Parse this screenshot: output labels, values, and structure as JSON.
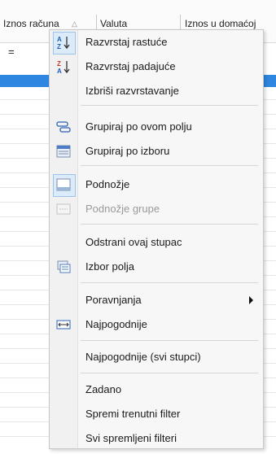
{
  "header": {
    "col1": "Iznos računa",
    "col2": "Valuta",
    "col3": "Iznos u domaćoj"
  },
  "filter_row": {
    "value": "="
  },
  "menu": {
    "items": [
      {
        "label": "Razvrstaj rastuće",
        "icon": "sort-ascending-icon"
      },
      {
        "label": "Razvrstaj padajuće",
        "icon": "sort-descending-icon"
      },
      {
        "label": "Izbriši razvrstavanje",
        "icon": ""
      },
      {
        "label": "Grupiraj po ovom polju",
        "icon": "group-by-field-icon"
      },
      {
        "label": "Grupiraj po izboru",
        "icon": "group-by-selection-icon"
      },
      {
        "label": "Podnožje",
        "icon": "footer-icon"
      },
      {
        "label": "Podnožje grupe",
        "icon": "group-footer-icon",
        "disabled": true
      },
      {
        "label": "Odstrani ovaj stupac",
        "icon": ""
      },
      {
        "label": "Izbor polja",
        "icon": "field-chooser-icon"
      },
      {
        "label": "Poravnjanja",
        "icon": "",
        "submenu": true
      },
      {
        "label": "Najpogodnije",
        "icon": "best-fit-icon"
      },
      {
        "label": "Najpogodnije (svi stupci)",
        "icon": ""
      },
      {
        "label": "Zadano",
        "icon": ""
      },
      {
        "label": "Spremi trenutni filter",
        "icon": ""
      },
      {
        "label": "Svi spremljeni filteri",
        "icon": ""
      }
    ]
  },
  "colors": {
    "selected_row": "#2f86e0",
    "menu_bg": "#f7f7f7"
  }
}
